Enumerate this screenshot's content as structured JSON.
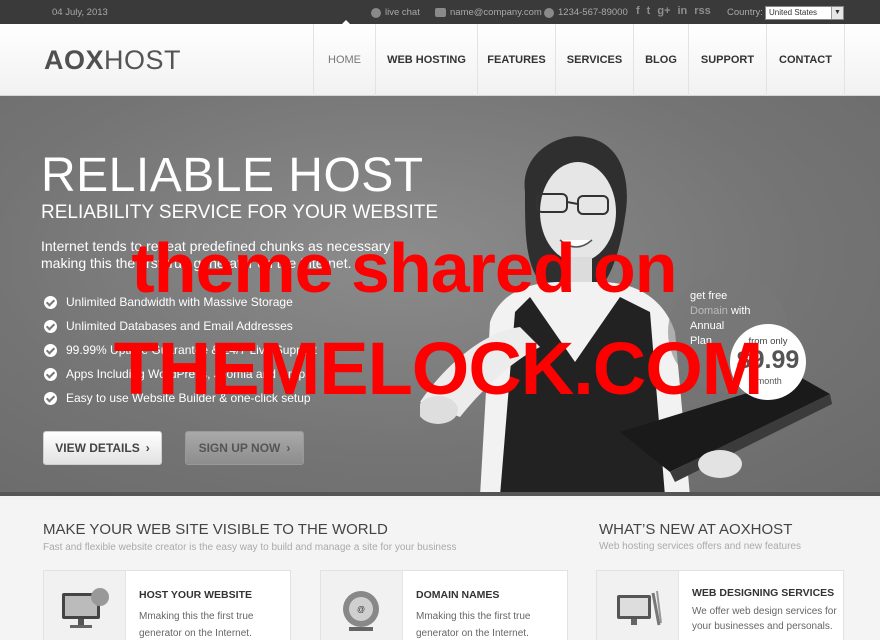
{
  "topbar": {
    "date": "04 July, 2013",
    "live_chat": "live chat",
    "email": "name@company.com",
    "phone": "1234-567-89000",
    "social": [
      "f",
      "t",
      "g+",
      "in",
      "rss"
    ],
    "country_label": "Country:",
    "country_value": "United States"
  },
  "header": {
    "logo_bold": "AOX",
    "logo_light": "HOST",
    "nav": [
      {
        "label": "HOME",
        "active": true
      },
      {
        "label": "WEB HOSTING"
      },
      {
        "label": "FEATURES"
      },
      {
        "label": "SERVICES"
      },
      {
        "label": "BLOG"
      },
      {
        "label": "SUPPORT"
      },
      {
        "label": "CONTACT"
      }
    ]
  },
  "hero": {
    "title": "RELIABLE HOST",
    "subtitle": "RELIABILITY SERVICE FOR YOUR WEBSITE",
    "desc_line1": "Internet tends to repeat predefined chunks as necessary",
    "desc_line2": "making this the first true generator on the Internet.",
    "features": [
      "Unlimited Bandwidth with Massive Storage",
      "Unlimited Databases and Email Addresses",
      "99.99% Uptime Guarantee & 24/7 Live Support",
      "Apps Including WordPress, Joomla and Drupal",
      "Easy to use Website Builder & one-click setup"
    ],
    "btn_view": "VIEW DETAILS",
    "btn_sign": "SIGN UP NOW",
    "offer": {
      "line1": "get free",
      "line2_dim": "Domain",
      "line2_rest": " with",
      "line3": "Annual",
      "line4": "Plan",
      "from": "from only",
      "price": "$9.99",
      "per": "/month"
    }
  },
  "watermark": {
    "line1": "theme shared on",
    "line2": "THEMELOCK.COM"
  },
  "sections": {
    "left_title": "MAKE YOUR WEB SITE VISIBLE TO THE WORLD",
    "left_sub": "Fast and flexible website creator is the easy way to build and manage a site for your business",
    "right_title": "WHAT’S NEW AT AOXHOST",
    "right_sub": "Web hosting services offers and new features",
    "cards": [
      {
        "title": "HOST YOUR WEBSITE",
        "text": "Mmaking this the first true generator on the Internet."
      },
      {
        "title": "DOMAIN NAMES",
        "text": "Mmaking this the first true generator on the Internet."
      },
      {
        "title": "WEB DESIGNING SERVICES",
        "text": "We offer web design services for your businesses and personals."
      }
    ]
  }
}
